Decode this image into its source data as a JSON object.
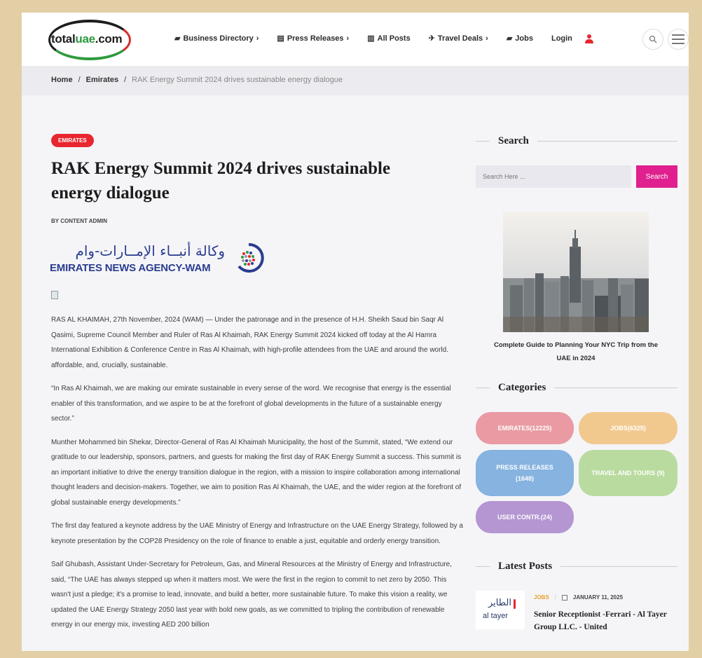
{
  "header": {
    "logo": {
      "text_dark": "total",
      "text_green": "uae",
      "text_suffix": ".com"
    },
    "nav": [
      {
        "label": "Business Directory",
        "icon": "briefcase-icon",
        "glyph": "▰",
        "suffix": "›"
      },
      {
        "label": "Press Releases",
        "icon": "newspaper-icon",
        "glyph": "▤",
        "suffix": "›"
      },
      {
        "label": "All Posts",
        "icon": "list-icon",
        "glyph": "▥",
        "suffix": ""
      },
      {
        "label": "Travel Deals",
        "icon": "plane-icon",
        "glyph": "✈",
        "suffix": "›"
      },
      {
        "label": "Jobs",
        "icon": "briefcase-icon",
        "glyph": "▰",
        "suffix": ""
      },
      {
        "label": "Login",
        "icon": "",
        "glyph": "",
        "suffix": ""
      }
    ]
  },
  "breadcrumb": {
    "home": "Home",
    "sep": "/",
    "section": "Emirates",
    "current": "RAK Energy Summit 2024 drives sustainable energy dialogue"
  },
  "article": {
    "badge": "EMIRATES",
    "title": "RAK Energy Summit 2024 drives sustainable energy dialogue",
    "byline": "BY CONTENT ADMIN",
    "wam_arabic": "وكالة أنبــاء الإمــارات-وام",
    "wam_english": "EMIRATES NEWS AGENCY-WAM",
    "paragraphs": [
      "RAS AL KHAIMAH, 27th November, 2024 (WAM) — Under the patronage and in the presence of H.H. Sheikh Saud bin Saqr Al Qasimi, Supreme Council Member and Ruler of Ras Al Khaimah, RAK Energy Summit 2024 kicked off today at the Al Hamra International Exhibition & Conference Centre in Ras Al Khaimah, with high-profile attendees from the UAE and around the world. affordable, and, crucially, sustainable.",
      "“In Ras Al Khaimah, we are making our emirate sustainable in every sense of the word. We recognise that energy is the essential enabler of this transformation, and we aspire to be at the forefront of global developments in the future of a sustainable energy sector.”",
      "Munther Mohammed bin Shekar, Director-General of Ras Al Khaimah Municipality, the host of the Summit, stated, “We extend our gratitude to our leadership, sponsors, partners, and guests for making the first day of RAK Energy Summit a success. This summit is an important initiative to drive the energy transition dialogue in the region, with a mission to inspire collaboration among international thought leaders and decision-makers. Together, we aim to position Ras Al Khaimah, the UAE, and the wider region at the forefront of global sustainable energy developments.”",
      "The first day featured a keynote address by the UAE Ministry of Energy and Infrastructure on the UAE Energy Strategy, followed by a keynote presentation by the COP28 Presidency on the role of finance to enable a just, equitable and orderly energy transition.",
      "Saif Ghubash, Assistant Under-Secretary for Petroleum, Gas, and Mineral Resources at the Ministry of Energy and Infrastructure, said, “The UAE has always stepped up when it matters most. We were the first in the region to commit to net zero by 2050. This wasn't just a pledge; it's a promise to lead, innovate, and build a better, more sustainable future. To make this vision a reality, we updated the UAE Energy Strategy 2050 last year with bold new goals, as we committed to tripling the contribution of renewable energy in our energy mix, investing AED 200 billion"
    ]
  },
  "sidebar": {
    "search_title": "Search",
    "search_placeholder": "Search Here ...",
    "search_button": "Search",
    "featured_caption": "Complete Guide to Planning Your NYC Trip from the UAE in 2024",
    "categories_title": "Categories",
    "categories": [
      {
        "label": "EMIRATES(12225)",
        "color": "#e99aa3"
      },
      {
        "label": "JOBS(6325)",
        "color": "#f1c98f"
      },
      {
        "label": "PRESS RELEASES (1648)",
        "color": "#86b3e0"
      },
      {
        "label": "TRAVEL AND TOURS (9)",
        "color": "#b9db9f"
      },
      {
        "label": "USER CONTR.(24)",
        "color": "#b596d2"
      }
    ],
    "latest_title": "Latest Posts",
    "latest_post": {
      "category": "JOBS",
      "date": "JANUARY 11, 2025",
      "title": "Senior Receptionist -Ferrari - Al Tayer Group LLC. - United",
      "thumb_arabic": "الطاير",
      "thumb_english": "al tayer"
    }
  },
  "colors": {
    "accent_red": "#e8262f",
    "accent_pink": "#e0208e",
    "frame": "#e3cfa6",
    "jobs_orange": "#e8a030"
  }
}
